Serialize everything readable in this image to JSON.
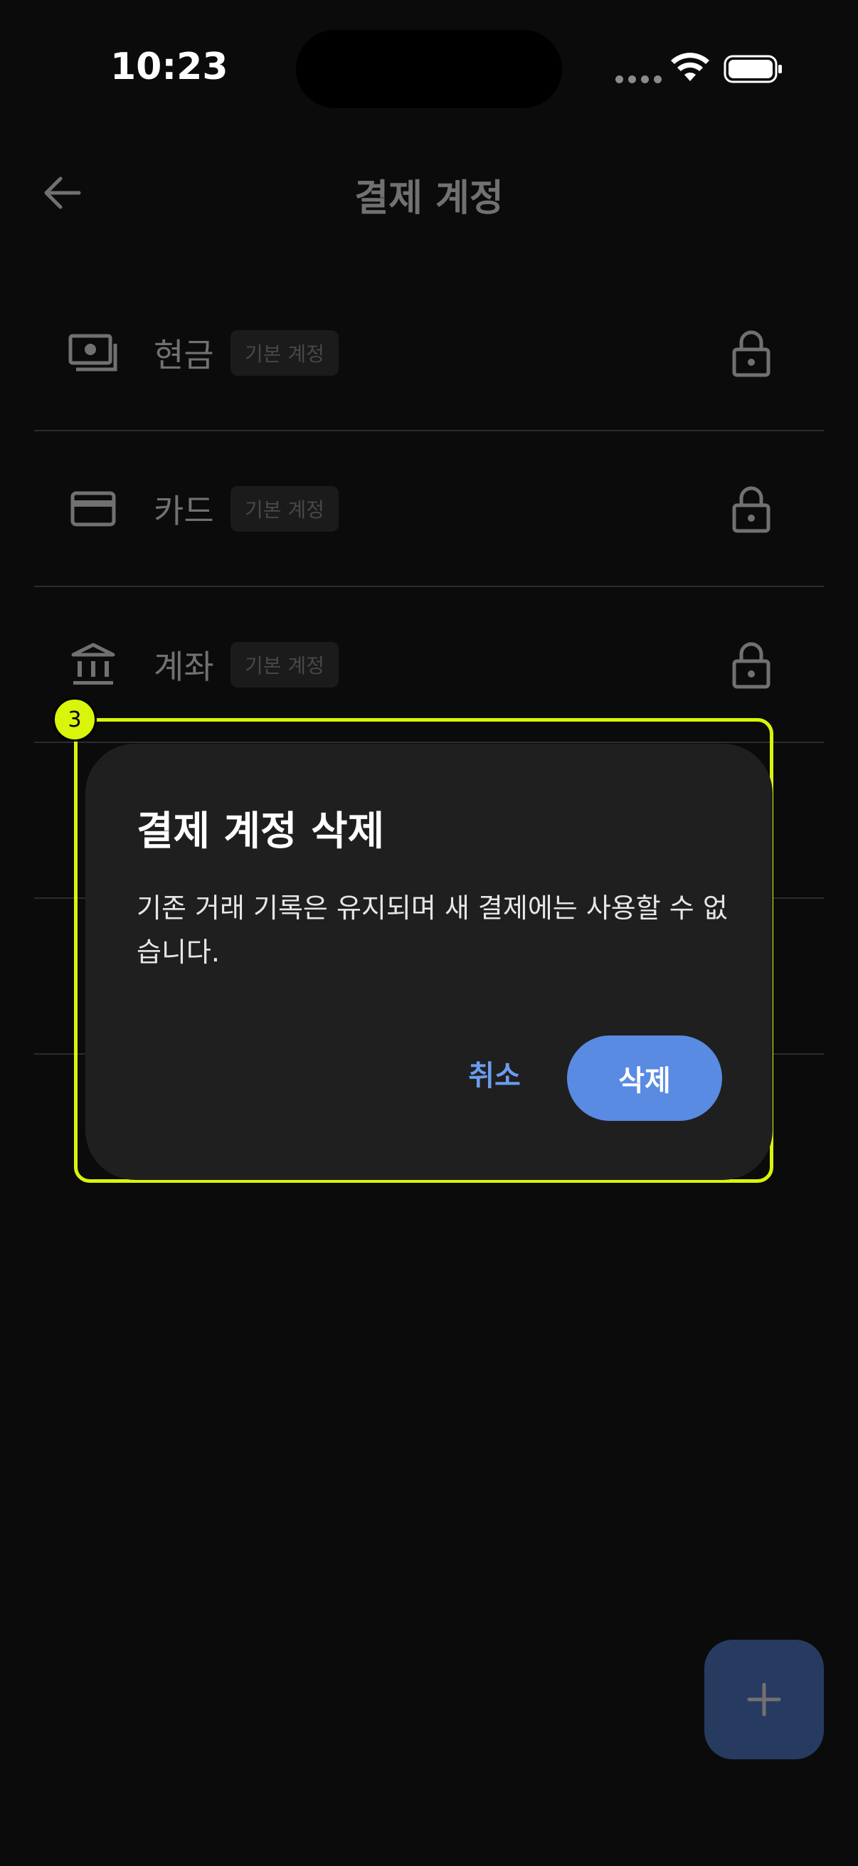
{
  "status_bar": {
    "time": "10:23"
  },
  "header": {
    "title": "결제 계정"
  },
  "accounts": [
    {
      "label": "현금",
      "badge": "기본 계정",
      "icon": "cash-icon"
    },
    {
      "label": "카드",
      "badge": "기본 계정",
      "icon": "card-icon"
    },
    {
      "label": "계좌",
      "badge": "기본 계정",
      "icon": "bank-icon"
    }
  ],
  "highlight": {
    "badge": "3",
    "color": "#d8f50a"
  },
  "dialog": {
    "title": "결제 계정 삭제",
    "message": "기존 거래 기록은 유지되며 새 결제에는 사용할 수 없습니다.",
    "cancel_label": "취소",
    "delete_label": "삭제"
  },
  "fab": {
    "icon": "plus-icon",
    "color": "#4f7fd8"
  }
}
